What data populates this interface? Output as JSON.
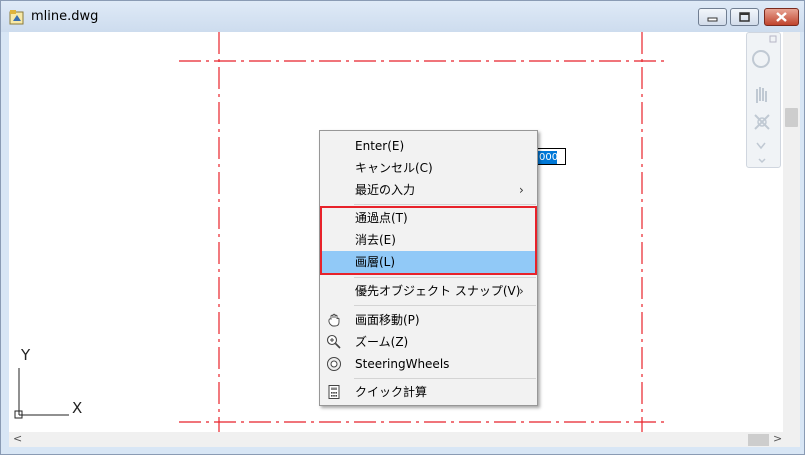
{
  "window": {
    "title": "mline.dwg",
    "accent_color": "#e8222a",
    "highlight_color": "#91c9f7"
  },
  "coordinate_input": {
    "visible_value": "000"
  },
  "ucs": {
    "y_label": "Y",
    "x_label": "X"
  },
  "context_menu": {
    "items": [
      {
        "label": "Enter(E)",
        "icon": ""
      },
      {
        "label": "キャンセル(C)",
        "icon": ""
      },
      {
        "label": "最近の入力",
        "icon": "",
        "submenu": true
      },
      {
        "label": "通過点(T)",
        "icon": ""
      },
      {
        "label": "消去(E)",
        "icon": ""
      },
      {
        "label": "画層(L)",
        "icon": "",
        "highlighted": true
      },
      {
        "label": "優先オブジェクト スナップ(V)",
        "icon": "",
        "submenu": true
      },
      {
        "label": "画面移動(P)",
        "icon": "pan-icon"
      },
      {
        "label": "ズーム(Z)",
        "icon": "zoom-icon"
      },
      {
        "label": "SteeringWheels",
        "icon": "steeringwheels-icon"
      },
      {
        "label": "クイック計算",
        "icon": "calculator-icon"
      }
    ],
    "submenu_glyph": "›"
  },
  "scrollbars": {
    "left_arrow": "<",
    "right_arrow": ">"
  }
}
